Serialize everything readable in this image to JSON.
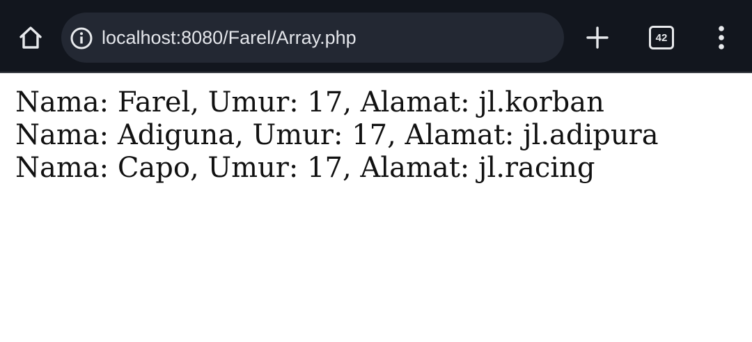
{
  "browser": {
    "url": "localhost:8080/Farel/Array.php",
    "tab_count": "42",
    "toolbar_color": "#12161e",
    "omnibox_color": "#232833",
    "icons": {
      "home": "home-icon",
      "info": "info-icon",
      "new_tab": "plus-icon",
      "tabs": "tab-switcher-icon",
      "menu": "more-vert-icon"
    }
  },
  "page": {
    "lines": [
      "Nama: Farel, Umur: 17, Alamat: jl.korban",
      "Nama: Adiguna, Umur: 17, Alamat: jl.adipura",
      "Nama: Capo, Umur: 17, Alamat: jl.racing"
    ]
  }
}
